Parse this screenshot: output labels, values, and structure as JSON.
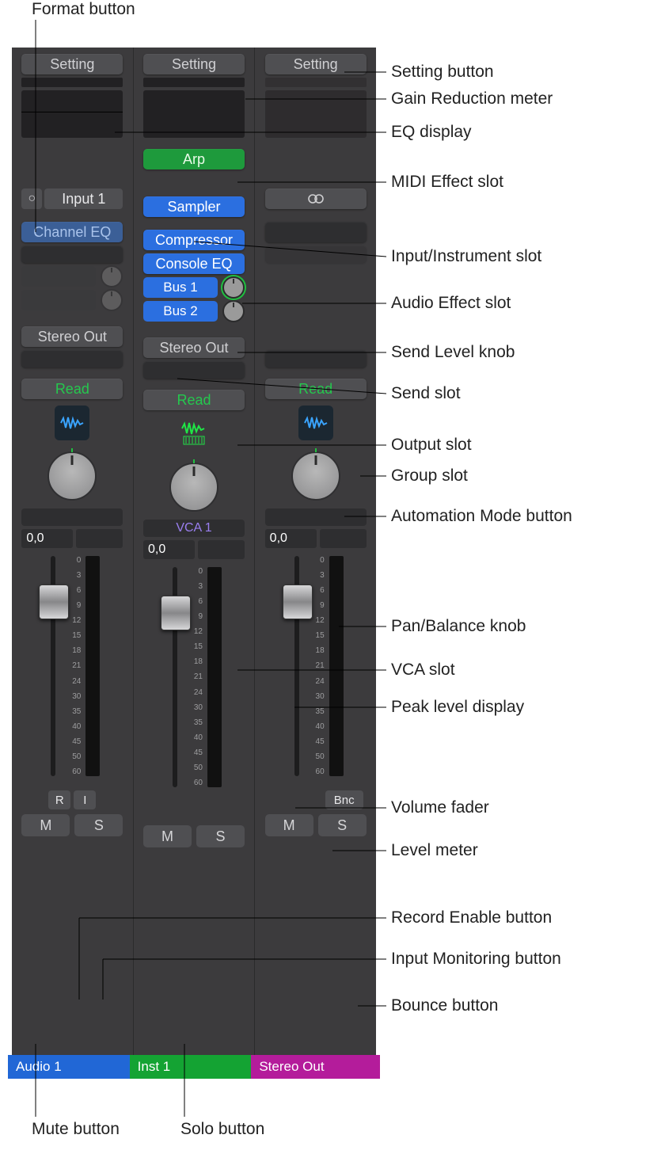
{
  "callouts": {
    "format": "Format button",
    "setting": "Setting button",
    "gain": "Gain Reduction meter",
    "eq": "EQ display",
    "midi": "MIDI Effect slot",
    "input": "Input/Instrument slot",
    "afx": "Audio Effect slot",
    "sendknob": "Send Level knob",
    "sendslot": "Send slot",
    "output": "Output slot",
    "group": "Group slot",
    "auto": "Automation Mode button",
    "pan": "Pan/Balance knob",
    "vca": "VCA slot",
    "peak": "Peak level display",
    "fader": "Volume fader",
    "meter": "Level meter",
    "rec": "Record Enable button",
    "mon": "Input Monitoring button",
    "bnc": "Bounce button",
    "mute": "Mute button",
    "solo": "Solo button"
  },
  "common": {
    "setting": "Setting",
    "read": "Read",
    "stereo_out": "Stereo Out",
    "peak": "0,0",
    "mute": "M",
    "solo": "S",
    "scale": [
      "0",
      "3",
      "6",
      "9",
      "12",
      "15",
      "18",
      "21",
      "24",
      "30",
      "35",
      "40",
      "45",
      "50",
      "60"
    ]
  },
  "strips": [
    {
      "name": "Audio 1",
      "color": "blue",
      "format": "○",
      "input": "Input 1",
      "inserts": [
        "Channel EQ"
      ],
      "record": "R",
      "monitor": "I"
    },
    {
      "name": "Inst 1",
      "color": "green",
      "midi_fx": "Arp",
      "instrument": "Sampler",
      "inserts": [
        "Compressor",
        "Console EQ"
      ],
      "sends": [
        "Bus 1",
        "Bus 2"
      ],
      "vca": "VCA 1"
    },
    {
      "name": "Stereo Out",
      "color": "mag",
      "input_icon": "⧉",
      "bnc": "Bnc"
    }
  ]
}
